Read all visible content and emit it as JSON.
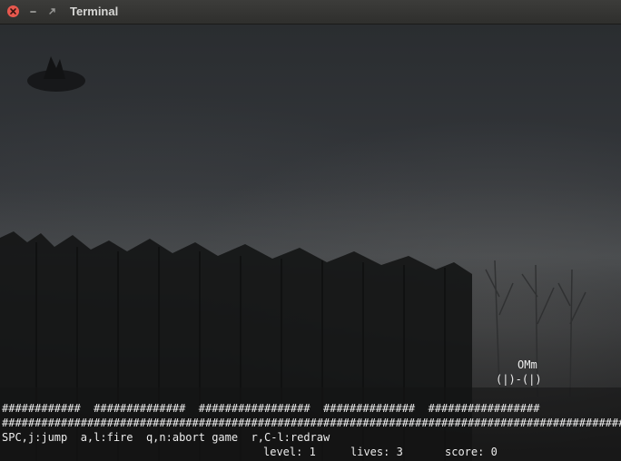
{
  "window": {
    "title": "Terminal"
  },
  "game": {
    "player_head": "OMm",
    "player_body": "(|)-(|)",
    "ground_top": "############  ##############  #################  ##############  #################",
    "ground_bottom": "##############################################################################################################",
    "help": "SPC,j:jump  a,l:fire  q,n:abort game  r,C-l:redraw",
    "status": {
      "level": "level: 1",
      "lives": "lives: 3",
      "score": "score: 0"
    }
  },
  "icons": {
    "close": "close-icon",
    "minimize": "minimize-icon",
    "maximize": "maximize-icon"
  },
  "colors": {
    "close_button": "#e8584e",
    "title_text": "#d6d6d4",
    "terminal_text": "#ececec"
  }
}
